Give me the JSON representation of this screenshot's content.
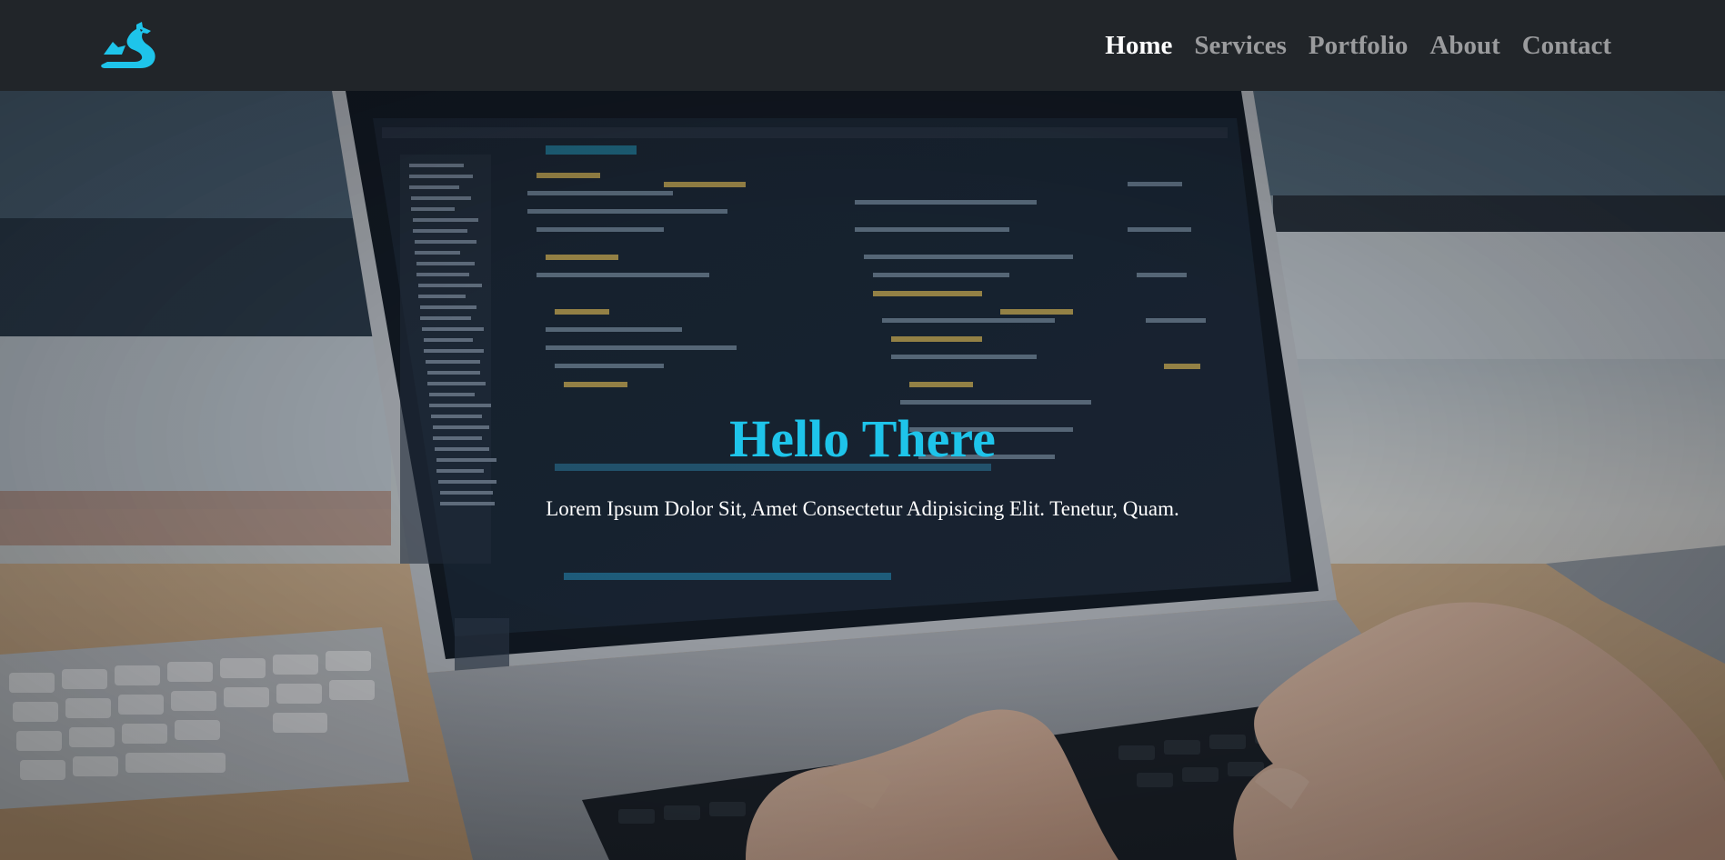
{
  "brand": {
    "logo_icon": "dragon-logo",
    "logo_color": "#1ec4ea"
  },
  "nav": {
    "items": [
      {
        "label": "Home",
        "active": true
      },
      {
        "label": "Services",
        "active": false
      },
      {
        "label": "Portfolio",
        "active": false
      },
      {
        "label": "About",
        "active": false
      },
      {
        "label": "Contact",
        "active": false
      }
    ]
  },
  "hero": {
    "title": "Hello There",
    "subtitle": "Lorem Ipsum Dolor Sit, Amet Consectetur Adipisicing Elit. Tenetur, Quam.",
    "background": "laptop-coding-photo"
  },
  "colors": {
    "navbar_bg": "#212529",
    "accent": "#1ec4ea",
    "nav_inactive": "#9a9b9d",
    "nav_active": "#ffffff"
  }
}
